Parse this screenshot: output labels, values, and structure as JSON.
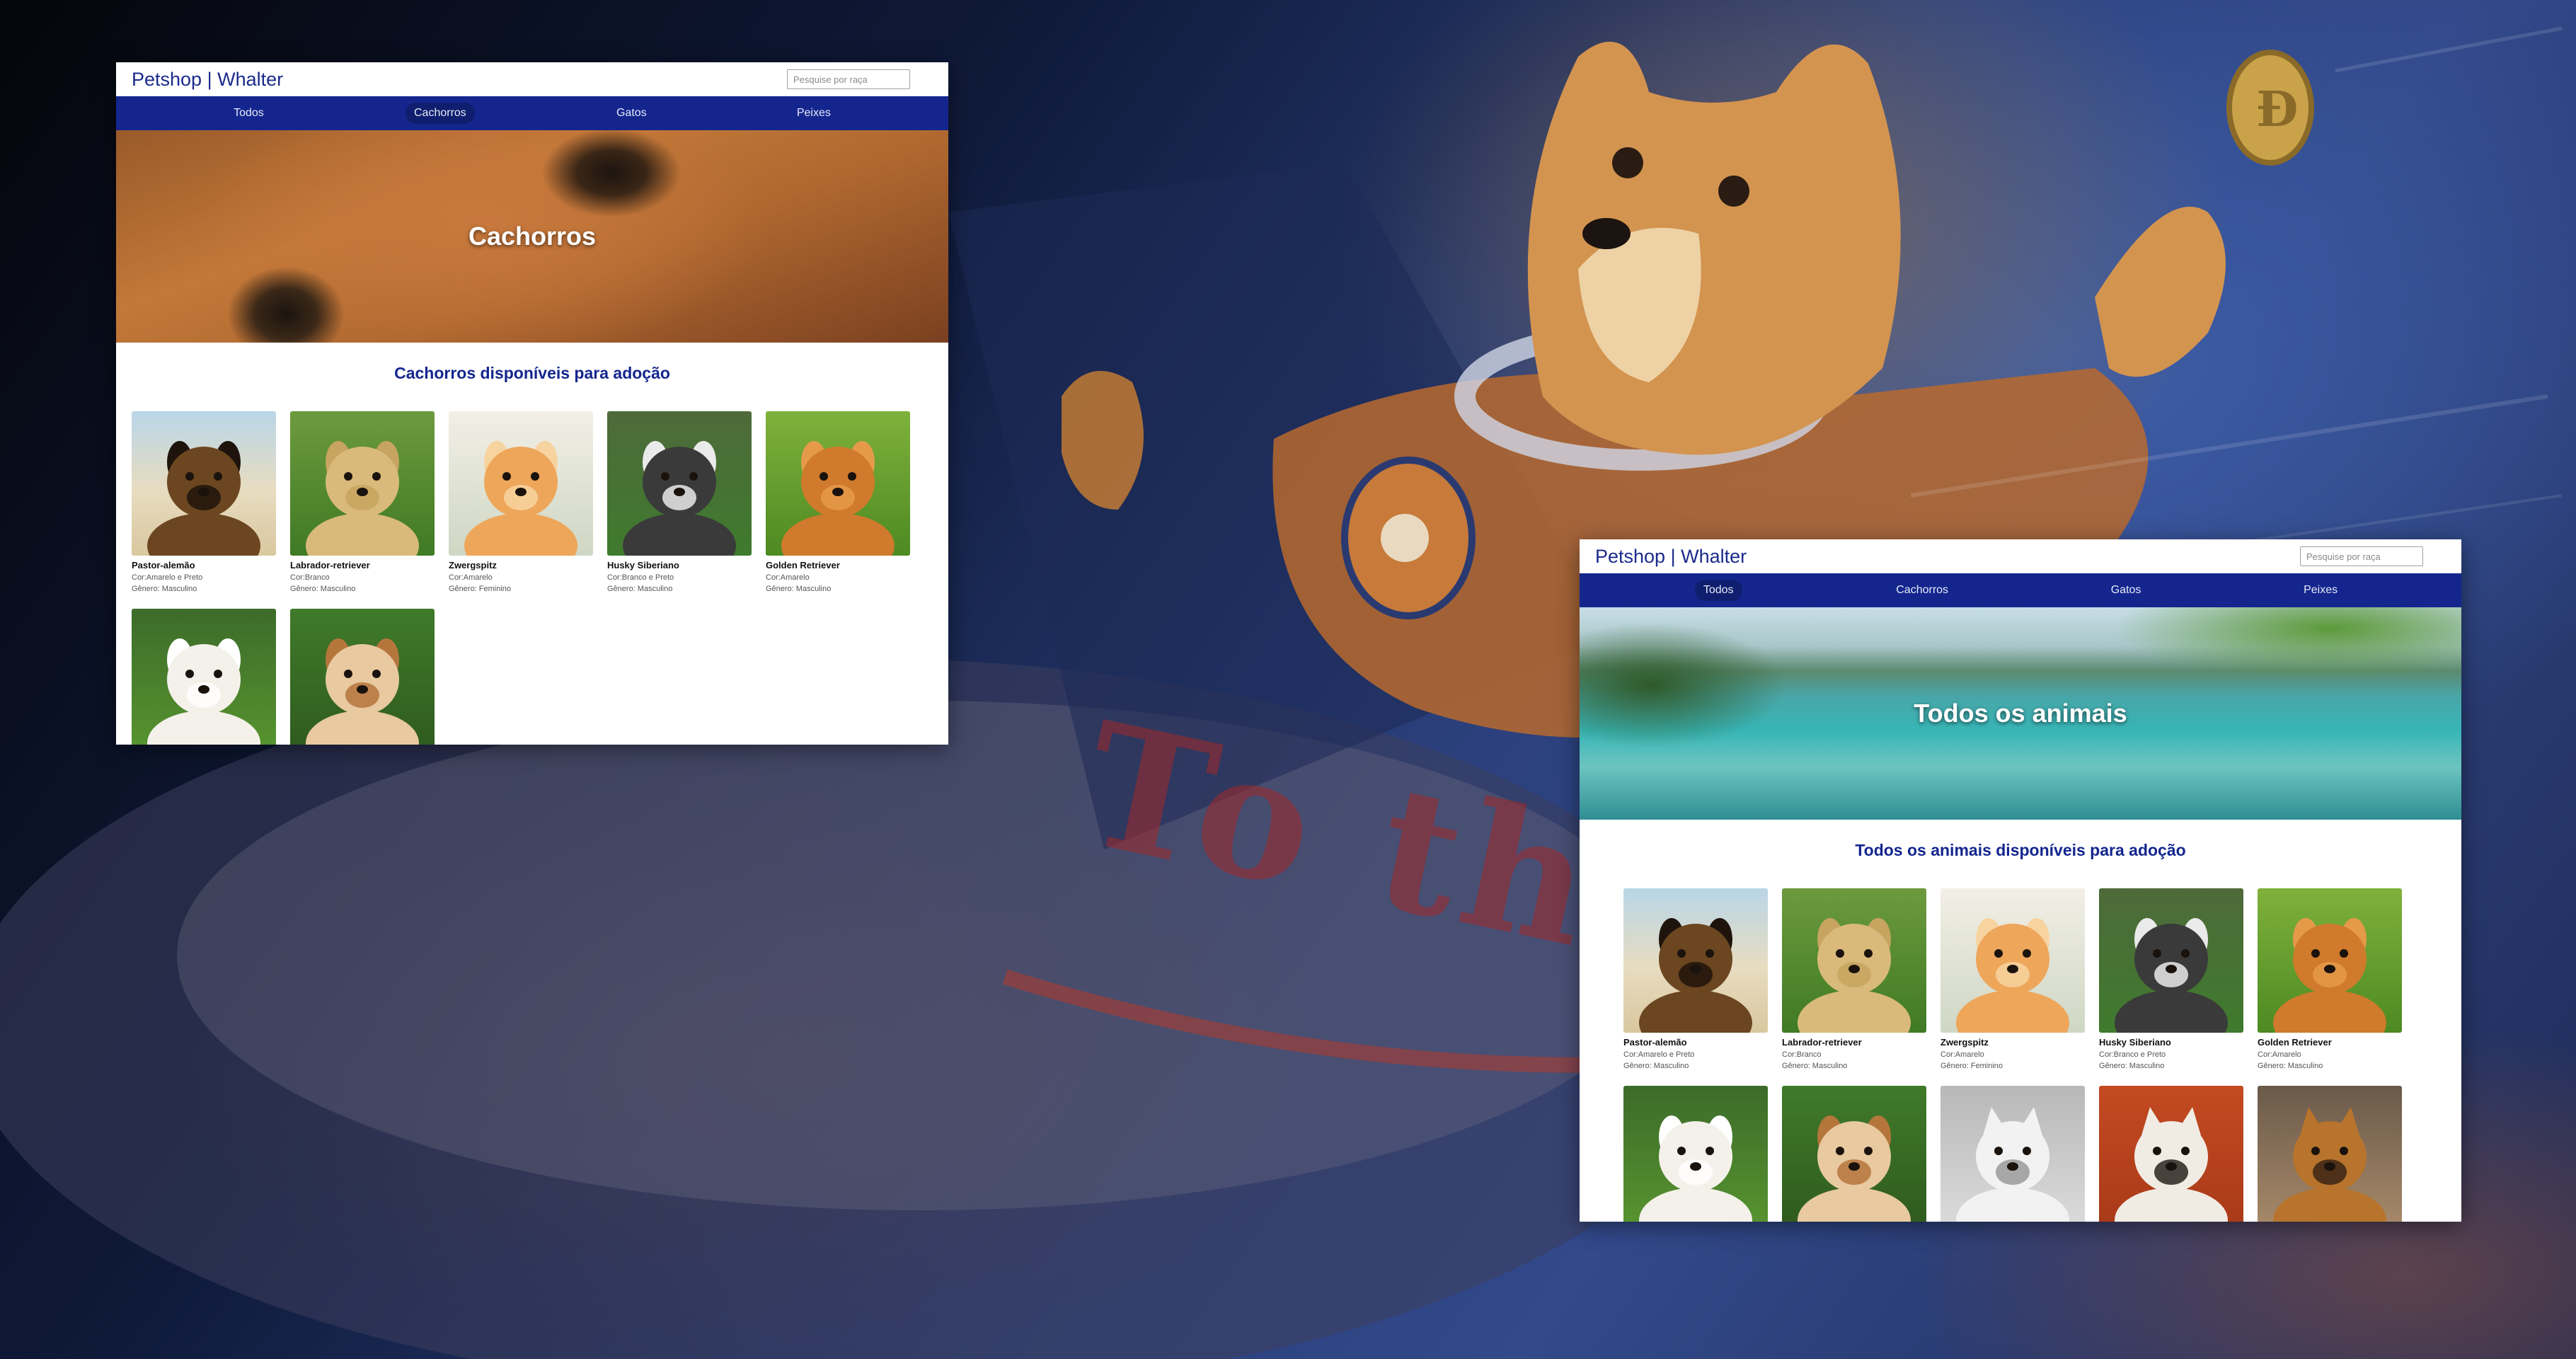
{
  "brand": "Petshop | Whalter",
  "search_placeholder": "Pesquise por raça",
  "background_text": "To the Moo",
  "nav": [
    "Todos",
    "Cachorros",
    "Gatos",
    "Peixes"
  ],
  "windows": [
    {
      "active_tab": "Cachorros",
      "hero_title": "Cachorros",
      "section_title": "Cachorros disponíveis para adoção",
      "animals": [
        {
          "name": "Pastor-alemão",
          "color": "Cor:Amarelo e Preto",
          "gender": "Gênero: Masculino",
          "photo": "german-shepherd"
        },
        {
          "name": "Labrador-retriever",
          "color": "Cor:Branco",
          "gender": "Gênero: Masculino",
          "photo": "labrador"
        },
        {
          "name": "Zwergspitz",
          "color": "Cor:Amarelo",
          "gender": "Gênero: Feminino",
          "photo": "pomeranian"
        },
        {
          "name": "Husky Siberiano",
          "color": "Cor:Branco e Preto",
          "gender": "Gênero: Masculino",
          "photo": "husky"
        },
        {
          "name": "Golden Retriever",
          "color": "Cor:Amarelo",
          "gender": "Gênero: Masculino",
          "photo": "golden-retriever"
        },
        {
          "name": "",
          "color": "",
          "gender": "",
          "photo": "poodle"
        },
        {
          "name": "",
          "color": "",
          "gender": "",
          "photo": "bulldog"
        }
      ]
    },
    {
      "active_tab": "Todos",
      "hero_title": "Todos os animais",
      "section_title": "Todos os animais disponíveis para adoção",
      "animals": [
        {
          "name": "Pastor-alemão",
          "color": "Cor:Amarelo e Preto",
          "gender": "Gênero: Masculino",
          "photo": "german-shepherd"
        },
        {
          "name": "Labrador-retriever",
          "color": "Cor:Branco",
          "gender": "Gênero: Masculino",
          "photo": "labrador"
        },
        {
          "name": "Zwergspitz",
          "color": "Cor:Amarelo",
          "gender": "Gênero: Feminino",
          "photo": "pomeranian"
        },
        {
          "name": "Husky Siberiano",
          "color": "Cor:Branco e Preto",
          "gender": "Gênero: Masculino",
          "photo": "husky"
        },
        {
          "name": "Golden Retriever",
          "color": "Cor:Amarelo",
          "gender": "Gênero: Masculino",
          "photo": "golden-retriever"
        },
        {
          "name": "",
          "color": "",
          "gender": "",
          "photo": "poodle"
        },
        {
          "name": "",
          "color": "",
          "gender": "",
          "photo": "bulldog"
        },
        {
          "name": "",
          "color": "",
          "gender": "",
          "photo": "persian-cat"
        },
        {
          "name": "",
          "color": "",
          "gender": "",
          "photo": "calico-cat"
        },
        {
          "name": "",
          "color": "",
          "gender": "",
          "photo": "bengal-cat"
        }
      ]
    }
  ],
  "colors": {
    "brand_blue": "#14268e",
    "nav_active": "#0f1e6e",
    "page_bg": "#ffffff"
  }
}
